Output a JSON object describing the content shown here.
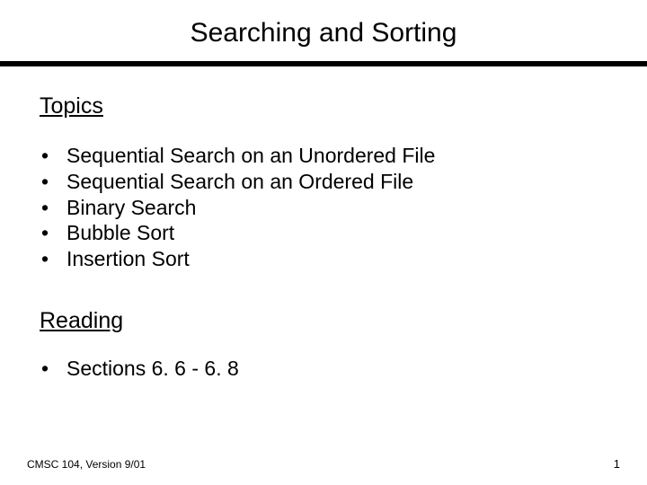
{
  "slide": {
    "title": "Searching and Sorting",
    "sections": {
      "topics": {
        "heading": "Topics",
        "items": [
          "Sequential Search on an Unordered File",
          "Sequential Search on an Ordered File",
          "Binary Search",
          "Bubble Sort",
          "Insertion Sort"
        ]
      },
      "reading": {
        "heading": "Reading",
        "items": [
          "Sections 6. 6 - 6. 8"
        ]
      }
    },
    "footer": {
      "left": "CMSC 104, Version 9/01",
      "right": "1"
    }
  }
}
